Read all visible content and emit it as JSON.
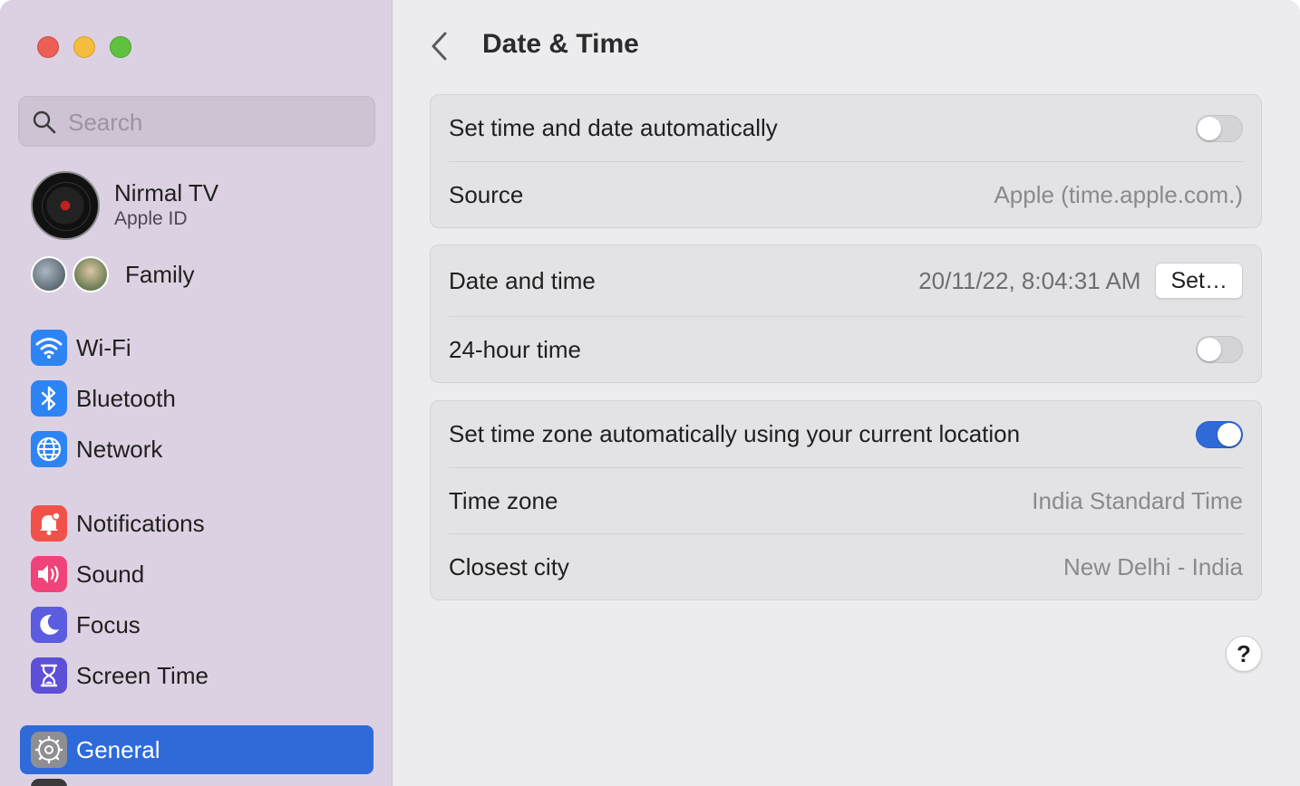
{
  "sidebar": {
    "search_placeholder": "Search",
    "account": {
      "name": "Nirmal TV",
      "subtitle": "Apple ID"
    },
    "family_label": "Family",
    "items": [
      {
        "label": "Wi-Fi",
        "icon": "wifi-icon"
      },
      {
        "label": "Bluetooth",
        "icon": "bluetooth-icon"
      },
      {
        "label": "Network",
        "icon": "globe-icon"
      },
      {
        "label": "Notifications",
        "icon": "bell-icon"
      },
      {
        "label": "Sound",
        "icon": "speaker-icon"
      },
      {
        "label": "Focus",
        "icon": "moon-icon"
      },
      {
        "label": "Screen Time",
        "icon": "hourglass-icon"
      },
      {
        "label": "General",
        "icon": "gear-icon",
        "selected": true
      }
    ]
  },
  "main": {
    "title": "Date & Time",
    "groups": [
      {
        "rows": [
          {
            "label": "Set time and date automatically",
            "toggle": false
          },
          {
            "label": "Source",
            "value": "Apple (time.apple.com.)"
          }
        ]
      },
      {
        "rows": [
          {
            "label": "Date and time",
            "value": "20/11/22, 8:04:31 AM",
            "button": "Set…"
          },
          {
            "label": "24-hour time",
            "toggle": false
          }
        ]
      },
      {
        "rows": [
          {
            "label": "Set time zone automatically using your current location",
            "toggle": true
          },
          {
            "label": "Time zone",
            "value": "India Standard Time"
          },
          {
            "label": "Closest city",
            "value": "New Delhi - India"
          }
        ]
      }
    ],
    "help_label": "?"
  },
  "colors": {
    "accent": "#2f6ad9",
    "sidebar_bg": "#dcd1e3",
    "content_bg": "#ececee"
  }
}
